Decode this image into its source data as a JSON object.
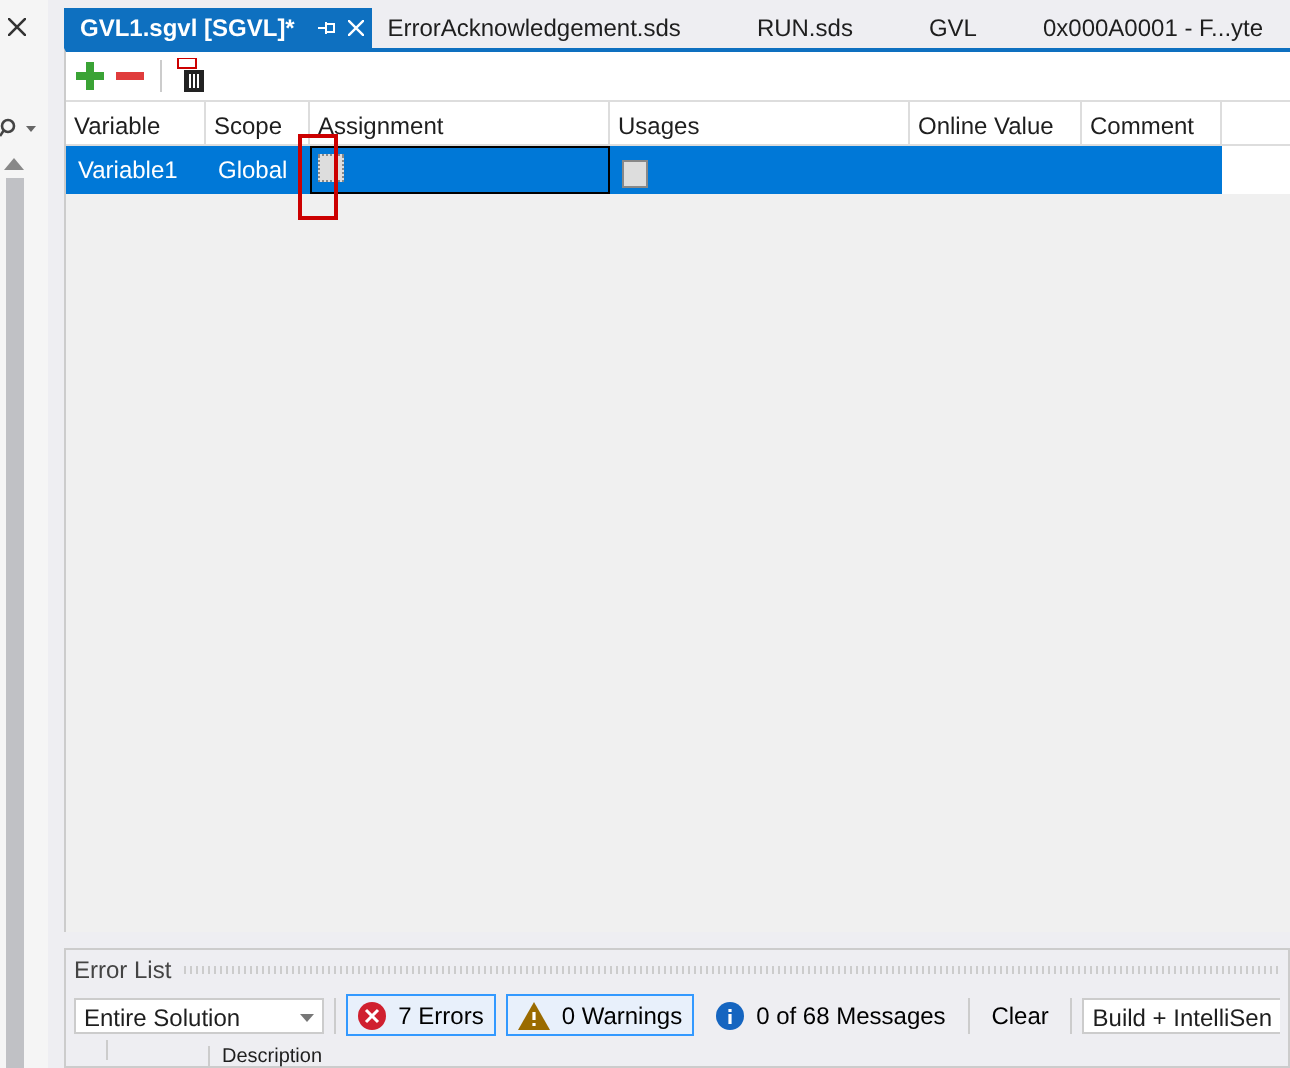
{
  "tabs": [
    {
      "label": "GVL1.sgvl [SGVL]*",
      "selected": true
    },
    {
      "label": "ErrorAcknowledgement.sds",
      "selected": false
    },
    {
      "label": "RUN.sds",
      "selected": false
    },
    {
      "label": "GVL",
      "selected": false
    },
    {
      "label": "0x000A0001 - F...yte",
      "selected": false
    }
  ],
  "table": {
    "columns": [
      "Variable",
      "Scope",
      "Assignment",
      "Usages",
      "Online Value",
      "Comment"
    ],
    "rows": [
      {
        "selected": true,
        "cells": [
          "Variable1",
          "Global"
        ]
      }
    ]
  },
  "error_list": {
    "title": "Error List",
    "scope": "Entire Solution",
    "filters": [
      {
        "kind": "errors",
        "label": "7 Errors",
        "selected": true
      },
      {
        "kind": "warnings",
        "label": "0 Warnings",
        "selected": true
      },
      {
        "kind": "messages",
        "label": "0 of 68 Messages",
        "selected": false
      }
    ],
    "clear": "Clear",
    "source": "Build + IntelliSen",
    "column": "Description"
  }
}
